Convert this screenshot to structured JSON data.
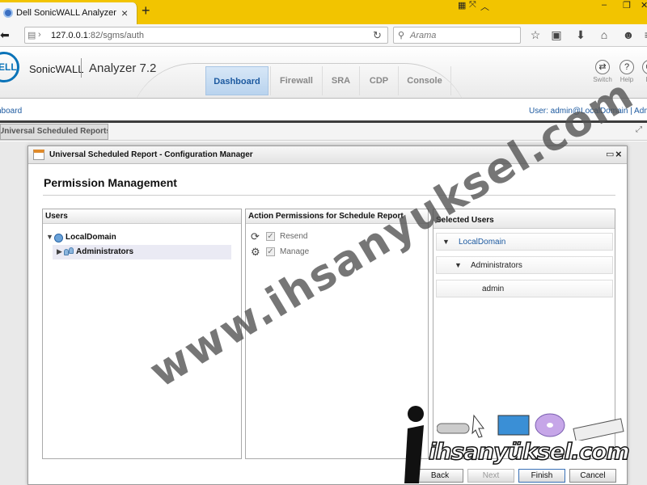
{
  "browser": {
    "tab_title": "Dell SonicWALL Analyzer",
    "url_host": "127.0.0.1",
    "url_path": ":82/sgms/auth",
    "search_placeholder": "Arama"
  },
  "app": {
    "brand": "SonicWALL",
    "product": "Analyzer 7.2",
    "logo_text": "DELL",
    "nav_tabs": [
      {
        "label": "Dashboard",
        "active": true
      },
      {
        "label": "Firewall",
        "active": false
      },
      {
        "label": "SRA",
        "active": false
      },
      {
        "label": "CDP",
        "active": false
      },
      {
        "label": "Console",
        "active": false
      }
    ],
    "tools": [
      {
        "label": "Switch",
        "icon": "switch-icon"
      },
      {
        "label": "Help",
        "icon": "help-icon"
      },
      {
        "label": "Lo",
        "icon": "logout-icon"
      }
    ],
    "breadcrumb": "hboard",
    "user_info": "User: admin@LocalDomain | Administ"
  },
  "report_tab": "Universal Scheduled Reports",
  "dialog": {
    "title": "Universal Scheduled Report - Configuration Manager",
    "section_title": "Permission Management",
    "users_panel": {
      "header": "Users",
      "domain": "LocalDomain",
      "group": "Administrators"
    },
    "actions_panel": {
      "header": "Action Permissions for Schedule Report",
      "items": [
        {
          "label": "Resend",
          "icon": "resend-icon",
          "checked": true
        },
        {
          "label": "Manage",
          "icon": "gear-icon",
          "checked": true
        }
      ]
    },
    "selected_panel": {
      "header": "Selected Users",
      "domain": "LocalDomain",
      "group": "Administrators",
      "user": "admin"
    },
    "buttons": {
      "back": "Back",
      "next": "Next",
      "finish": "Finish",
      "cancel": "Cancel"
    }
  },
  "watermark": {
    "url": "www.ihsanyuksel.com",
    "logo": "ihsanyüksel.com"
  },
  "colors": {
    "tab_bar": "#f2c400",
    "accent_blue": "#1d5aa0",
    "dell_blue": "#0a73b8"
  }
}
